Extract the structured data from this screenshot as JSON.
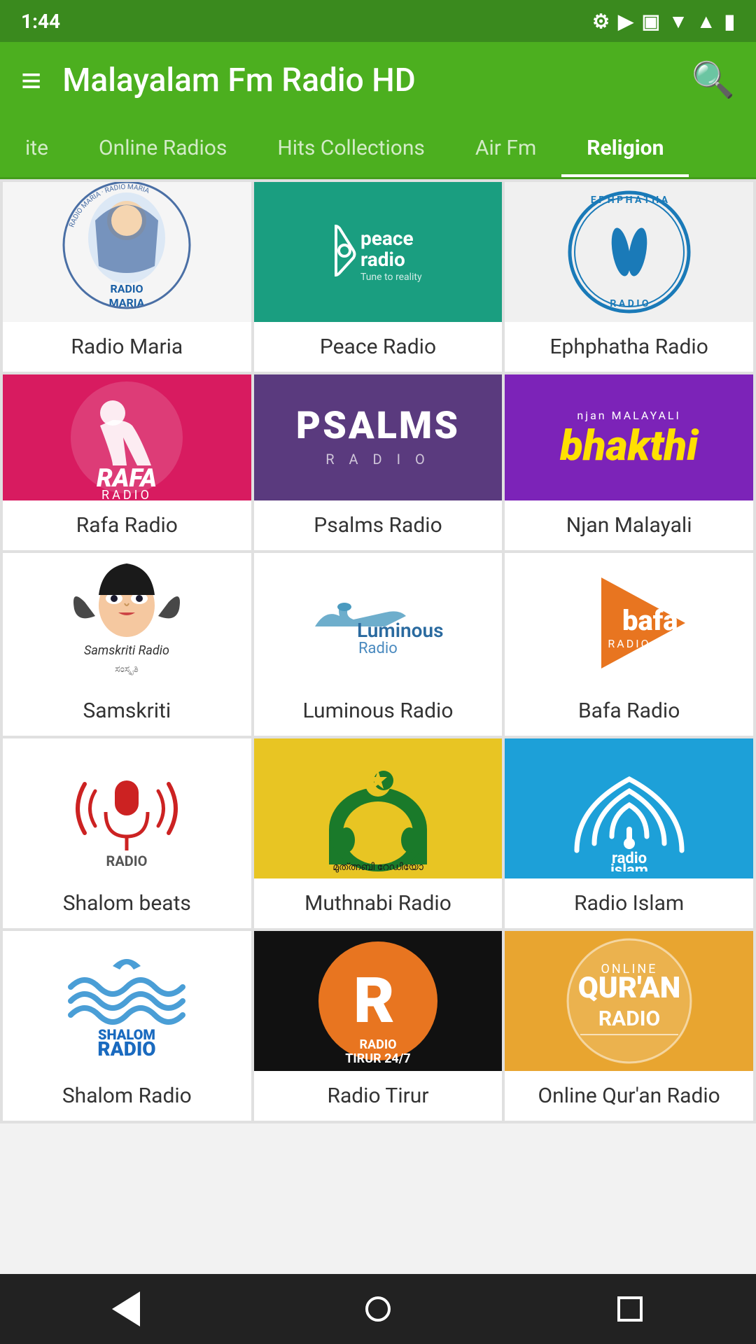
{
  "statusBar": {
    "time": "1:44",
    "icons": [
      "settings",
      "play",
      "sd-card",
      "wifi",
      "signal",
      "battery"
    ]
  },
  "header": {
    "menuIcon": "≡",
    "title": "Malayalam Fm Radio HD",
    "searchIcon": "🔍"
  },
  "tabs": [
    {
      "id": "favourite",
      "label": "ite",
      "active": false
    },
    {
      "id": "online",
      "label": "Online Radios",
      "active": false
    },
    {
      "id": "hits",
      "label": "Hits Collections",
      "active": false
    },
    {
      "id": "airfm",
      "label": "Air Fm",
      "active": false
    },
    {
      "id": "religion",
      "label": "Religion",
      "active": true
    }
  ],
  "stations": [
    {
      "id": "radio-maria",
      "name": "Radio Maria",
      "bg": "white"
    },
    {
      "id": "peace-radio",
      "name": "Peace Radio",
      "bg": "teal"
    },
    {
      "id": "ephphatha-radio",
      "name": "Ephphatha Radio",
      "bg": "light"
    },
    {
      "id": "rafa-radio",
      "name": "Rafa Radio",
      "bg": "pink"
    },
    {
      "id": "psalms-radio",
      "name": "Psalms Radio",
      "bg": "dark-purple"
    },
    {
      "id": "njan-malayali",
      "name": "Njan Malayali",
      "bg": "purple"
    },
    {
      "id": "samskriti",
      "name": "Samskriti",
      "bg": "white"
    },
    {
      "id": "luminous-radio",
      "name": "Luminous Radio",
      "bg": "white"
    },
    {
      "id": "bafa-radio",
      "name": "Bafa Radio",
      "bg": "white"
    },
    {
      "id": "shalom-beats",
      "name": "Shalom beats",
      "bg": "white"
    },
    {
      "id": "muthnabi-radio",
      "name": "Muthnabi Radio",
      "bg": "yellow"
    },
    {
      "id": "radio-islam",
      "name": "Radio Islam",
      "bg": "blue"
    },
    {
      "id": "shalom-radio",
      "name": "Shalom Radio",
      "bg": "white"
    },
    {
      "id": "radio-tirur",
      "name": "Radio Tirur",
      "bg": "black"
    },
    {
      "id": "quran-radio",
      "name": "Online Qur'an Radio",
      "bg": "amber"
    }
  ],
  "bottomNav": {
    "back": "◀",
    "home": "●",
    "recent": "■"
  }
}
